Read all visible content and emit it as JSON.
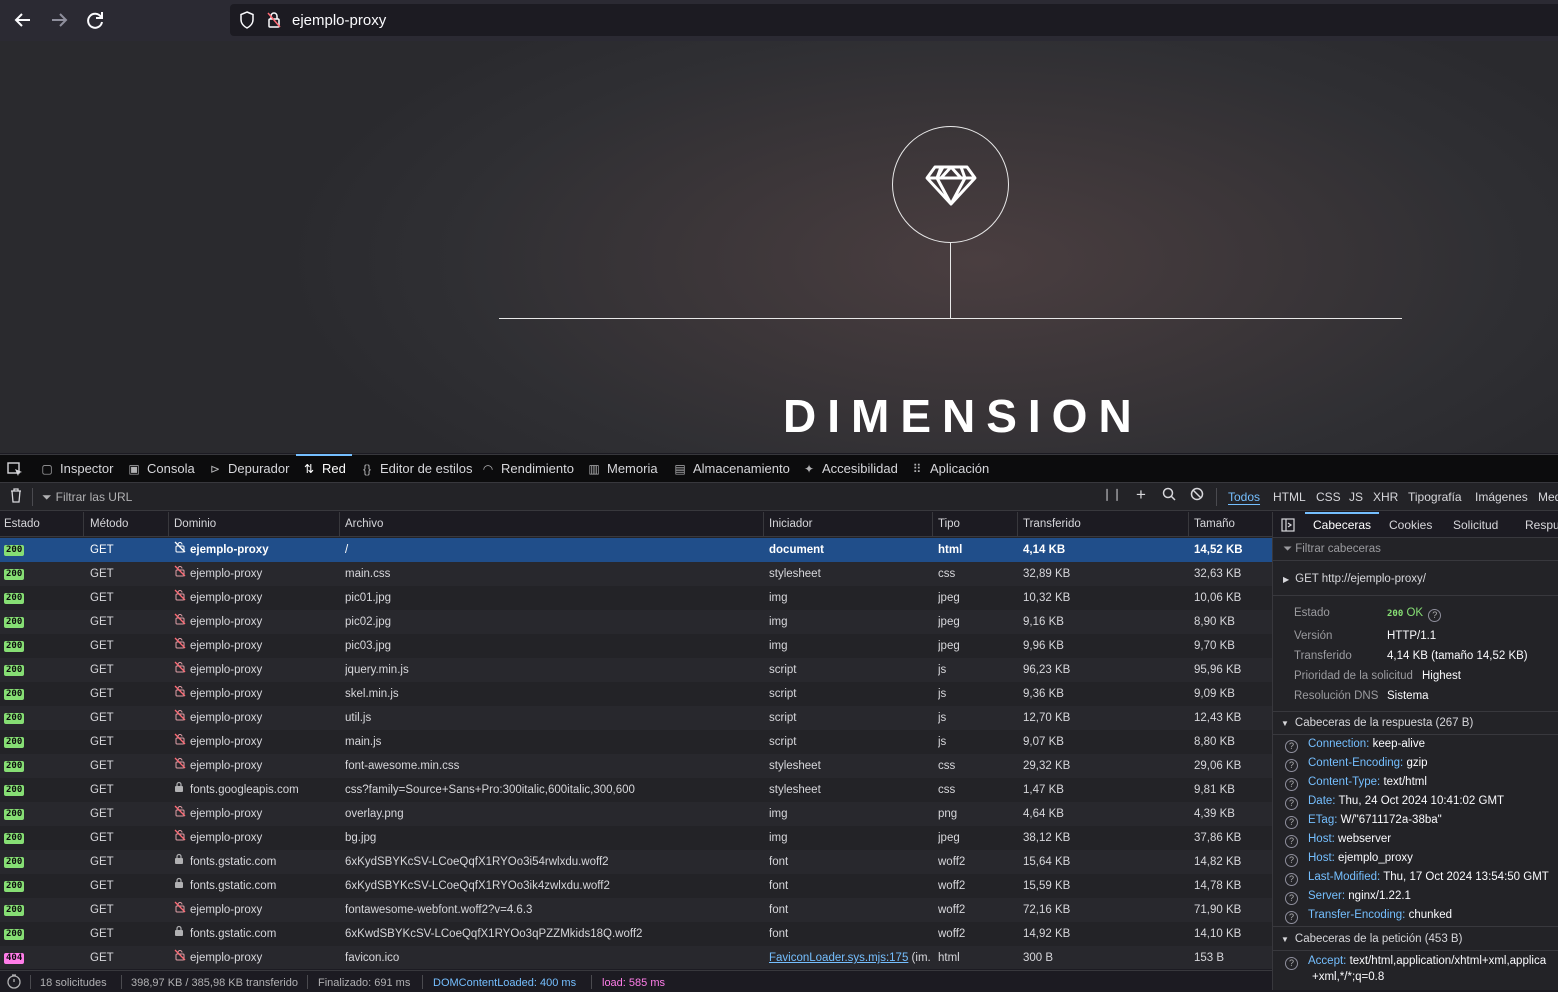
{
  "browser": {
    "url": "ejemplo-proxy"
  },
  "page": {
    "title": "DIMENSION"
  },
  "devtools": {
    "tabs": [
      "Inspector",
      "Consola",
      "Depurador",
      "Red",
      "Editor de estilos",
      "Rendimiento",
      "Memoria",
      "Almacenamiento",
      "Accesibilidad",
      "Aplicación"
    ],
    "active_tab": "Red",
    "filter_placeholder": "Filtrar las URL",
    "type_filters": [
      "Todos",
      "HTML",
      "CSS",
      "JS",
      "XHR",
      "Tipografía",
      "Imágenes",
      "Med"
    ],
    "active_filter": "Todos",
    "columns": [
      "Estado",
      "Método",
      "Dominio",
      "Archivo",
      "Iniciador",
      "Tipo",
      "Transferido",
      "Tamaño"
    ],
    "requests": [
      {
        "status": "200",
        "method": "GET",
        "secure": false,
        "domain": "ejemplo-proxy",
        "file": "/",
        "initiator": "document",
        "type": "html",
        "transferred": "4,14 KB",
        "size": "14,52 KB",
        "selected": true
      },
      {
        "status": "200",
        "method": "GET",
        "secure": false,
        "domain": "ejemplo-proxy",
        "file": "main.css",
        "initiator": "stylesheet",
        "type": "css",
        "transferred": "32,89 KB",
        "size": "32,63 KB"
      },
      {
        "status": "200",
        "method": "GET",
        "secure": false,
        "domain": "ejemplo-proxy",
        "file": "pic01.jpg",
        "initiator": "img",
        "type": "jpeg",
        "transferred": "10,32 KB",
        "size": "10,06 KB"
      },
      {
        "status": "200",
        "method": "GET",
        "secure": false,
        "domain": "ejemplo-proxy",
        "file": "pic02.jpg",
        "initiator": "img",
        "type": "jpeg",
        "transferred": "9,16 KB",
        "size": "8,90 KB"
      },
      {
        "status": "200",
        "method": "GET",
        "secure": false,
        "domain": "ejemplo-proxy",
        "file": "pic03.jpg",
        "initiator": "img",
        "type": "jpeg",
        "transferred": "9,96 KB",
        "size": "9,70 KB"
      },
      {
        "status": "200",
        "method": "GET",
        "secure": false,
        "domain": "ejemplo-proxy",
        "file": "jquery.min.js",
        "initiator": "script",
        "type": "js",
        "transferred": "96,23 KB",
        "size": "95,96 KB"
      },
      {
        "status": "200",
        "method": "GET",
        "secure": false,
        "domain": "ejemplo-proxy",
        "file": "skel.min.js",
        "initiator": "script",
        "type": "js",
        "transferred": "9,36 KB",
        "size": "9,09 KB"
      },
      {
        "status": "200",
        "method": "GET",
        "secure": false,
        "domain": "ejemplo-proxy",
        "file": "util.js",
        "initiator": "script",
        "type": "js",
        "transferred": "12,70 KB",
        "size": "12,43 KB"
      },
      {
        "status": "200",
        "method": "GET",
        "secure": false,
        "domain": "ejemplo-proxy",
        "file": "main.js",
        "initiator": "script",
        "type": "js",
        "transferred": "9,07 KB",
        "size": "8,80 KB"
      },
      {
        "status": "200",
        "method": "GET",
        "secure": false,
        "domain": "ejemplo-proxy",
        "file": "font-awesome.min.css",
        "initiator": "stylesheet",
        "type": "css",
        "transferred": "29,32 KB",
        "size": "29,06 KB"
      },
      {
        "status": "200",
        "method": "GET",
        "secure": true,
        "domain": "fonts.googleapis.com",
        "file": "css?family=Source+Sans+Pro:300italic,600italic,300,600",
        "initiator": "stylesheet",
        "type": "css",
        "transferred": "1,47 KB",
        "size": "9,81 KB"
      },
      {
        "status": "200",
        "method": "GET",
        "secure": false,
        "domain": "ejemplo-proxy",
        "file": "overlay.png",
        "initiator": "img",
        "type": "png",
        "transferred": "4,64 KB",
        "size": "4,39 KB"
      },
      {
        "status": "200",
        "method": "GET",
        "secure": false,
        "domain": "ejemplo-proxy",
        "file": "bg.jpg",
        "initiator": "img",
        "type": "jpeg",
        "transferred": "38,12 KB",
        "size": "37,86 KB"
      },
      {
        "status": "200",
        "method": "GET",
        "secure": true,
        "domain": "fonts.gstatic.com",
        "file": "6xKydSBYKcSV-LCoeQqfX1RYOo3i54rwlxdu.woff2",
        "initiator": "font",
        "type": "woff2",
        "transferred": "15,64 KB",
        "size": "14,82 KB"
      },
      {
        "status": "200",
        "method": "GET",
        "secure": true,
        "domain": "fonts.gstatic.com",
        "file": "6xKydSBYKcSV-LCoeQqfX1RYOo3ik4zwlxdu.woff2",
        "initiator": "font",
        "type": "woff2",
        "transferred": "15,59 KB",
        "size": "14,78 KB"
      },
      {
        "status": "200",
        "method": "GET",
        "secure": false,
        "domain": "ejemplo-proxy",
        "file": "fontawesome-webfont.woff2?v=4.6.3",
        "initiator": "font",
        "type": "woff2",
        "transferred": "72,16 KB",
        "size": "71,90 KB"
      },
      {
        "status": "200",
        "method": "GET",
        "secure": true,
        "domain": "fonts.gstatic.com",
        "file": "6xKwdSBYKcSV-LCoeQqfX1RYOo3qPZZMkids18Q.woff2",
        "initiator": "font",
        "type": "woff2",
        "transferred": "14,92 KB",
        "size": "14,10 KB"
      },
      {
        "status": "404",
        "method": "GET",
        "secure": false,
        "domain": "ejemplo-proxy",
        "file": "favicon.ico",
        "initiator": "FaviconLoader.sys.mjs:175",
        "initiator_suffix": " (im...",
        "type": "html",
        "transferred": "300 B",
        "size": "153 B"
      }
    ],
    "status_bar": {
      "requests": "18 solicitudes",
      "transferred": "398,97 KB / 385,98 KB transferido",
      "finished": "Finalizado: 691 ms",
      "dcl": "DOMContentLoaded: 400 ms",
      "load": "load: 585 ms"
    },
    "side_panel": {
      "tabs": [
        "Cabeceras",
        "Cookies",
        "Solicitud",
        "Respue"
      ],
      "active_tab": "Cabeceras",
      "filter_placeholder": "Filtrar cabeceras",
      "request_line": "GET  http://ejemplo-proxy/",
      "summary": [
        {
          "label": "Estado",
          "value": "200 OK"
        },
        {
          "label": "Versión",
          "value": "HTTP/1.1"
        },
        {
          "label": "Transferido",
          "value": "4,14 KB (tamaño 14,52 KB)"
        },
        {
          "label": "Prioridad de la solicitud",
          "value": "Highest"
        },
        {
          "label": "Resolución DNS",
          "value": "Sistema"
        }
      ],
      "response_headers_title": "Cabeceras de la respuesta (267 B)",
      "response_headers": [
        {
          "name": "Connection:",
          "value": "keep-alive"
        },
        {
          "name": "Content-Encoding:",
          "value": "gzip"
        },
        {
          "name": "Content-Type:",
          "value": "text/html"
        },
        {
          "name": "Date:",
          "value": "Thu, 24 Oct 2024 10:41:02 GMT"
        },
        {
          "name": "ETag:",
          "value": "W/\"6711172a-38ba\""
        },
        {
          "name": "Host:",
          "value": "webserver"
        },
        {
          "name": "Host:",
          "value": "ejemplo_proxy"
        },
        {
          "name": "Last-Modified:",
          "value": "Thu, 17 Oct 2024 13:54:50 GMT"
        },
        {
          "name": "Server:",
          "value": "nginx/1.22.1"
        },
        {
          "name": "Transfer-Encoding:",
          "value": "chunked"
        }
      ],
      "request_headers_title": "Cabeceras de la petición (453 B)",
      "request_headers": [
        {
          "name": "Accept:",
          "value": "text/html,application/xhtml+xml,applica",
          "cont": "+xml,*/*;q=0.8"
        }
      ]
    }
  },
  "colors": {
    "accent": "#75bfff",
    "ok_badge": "#86de74",
    "error_badge": "#ff7de9",
    "selected_row": "#204e8a"
  }
}
